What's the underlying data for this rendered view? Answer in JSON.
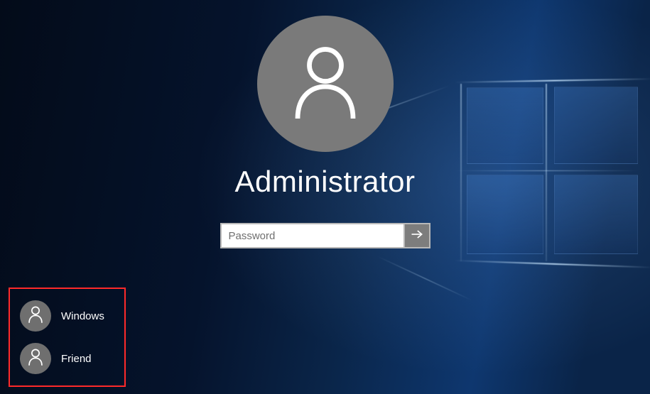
{
  "login": {
    "current_user": "Administrator",
    "password_placeholder": "Password",
    "password_value": "",
    "avatar_icon": "person-icon",
    "submit_icon": "arrow-right-icon"
  },
  "other_users": [
    {
      "name": "Windows",
      "avatar_icon": "person-icon"
    },
    {
      "name": "Friend",
      "avatar_icon": "person-icon"
    }
  ],
  "colors": {
    "avatar_bg": "#7a7a7a",
    "submit_bg": "#7d7d7d",
    "highlight_border": "#ff2a2a",
    "text": "#ffffff"
  }
}
